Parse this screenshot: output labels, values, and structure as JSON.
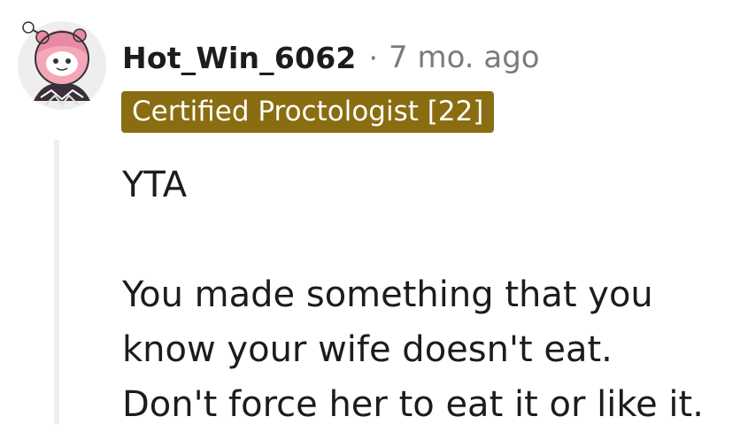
{
  "comment": {
    "username": "Hot_Win_6062",
    "separator": "·",
    "timestamp": "7 mo. ago",
    "flair": "Certified Proctologist [22]",
    "body": {
      "line1": "YTA",
      "line2": "You made something that you",
      "line3": "know your wife doesn't eat.",
      "line4": "Don't force her to eat it or like it."
    }
  },
  "colors": {
    "flair_background": "#8a6d10",
    "meta_text": "#787c7e",
    "thread_line": "#edeff1",
    "text": "#1c1c1c"
  },
  "icons": {
    "avatar": "snoo-avatar-icon"
  }
}
